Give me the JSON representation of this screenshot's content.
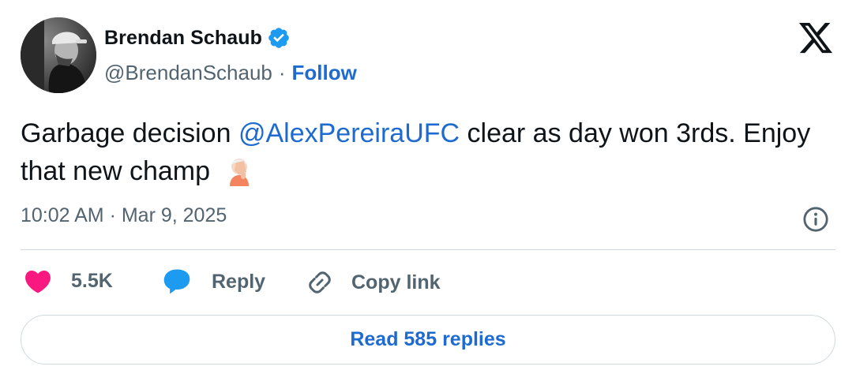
{
  "author": {
    "display_name": "Brendan Schaub",
    "handle": "@BrendanSchaub",
    "separator": "·",
    "follow_label": "Follow"
  },
  "tweet": {
    "text_before": "Garbage decision ",
    "mention": "@AlexPereiraUFC",
    "text_after": " clear as day won 3rds. Enjoy that new champ",
    "emoji": "facepalm-emoji",
    "timestamp": "10:02 AM · Mar 9, 2025"
  },
  "actions": {
    "likes_count": "5.5K",
    "reply_label": "Reply",
    "copy_link_label": "Copy link"
  },
  "read_replies_label": "Read 585 replies",
  "icons": [
    "verified-badge-icon",
    "x-logo-icon",
    "info-icon",
    "heart-icon",
    "reply-bubble-icon",
    "link-icon"
  ],
  "colors": {
    "link_blue": "#1d6ad0",
    "verified_blue": "#1d9bf0",
    "heart_pink": "#f91880",
    "reply_blue": "#1d9bf0",
    "muted_text": "#536471",
    "divider": "#cfd9de"
  }
}
